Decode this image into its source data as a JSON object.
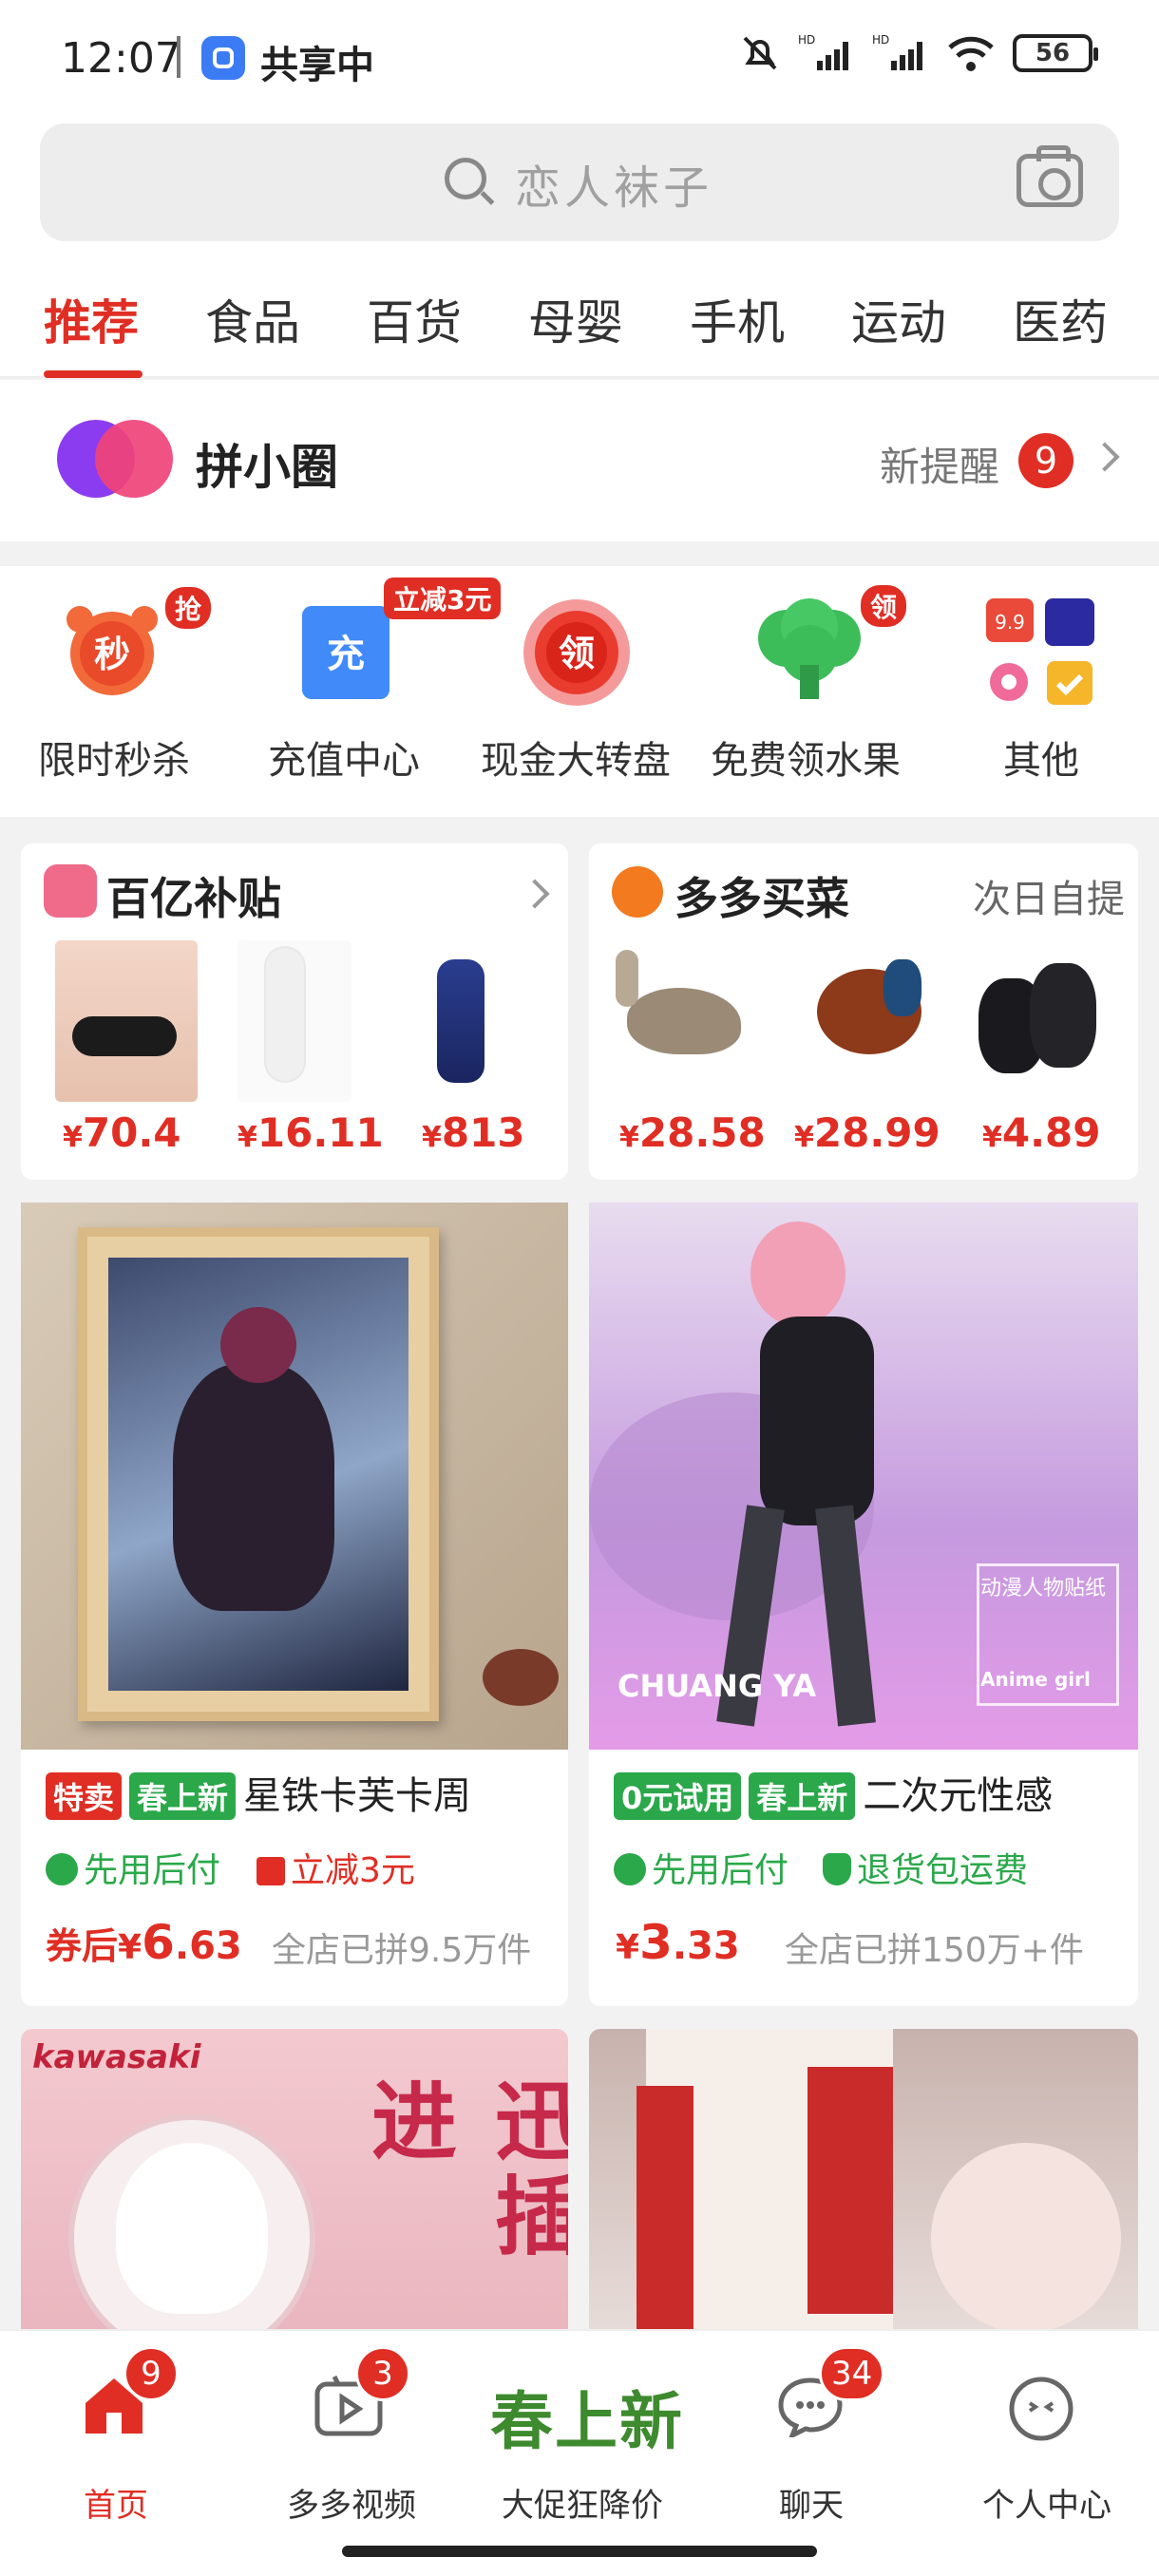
{
  "status": {
    "time": "12:07",
    "share_text": "共享中",
    "battery": "56"
  },
  "search": {
    "placeholder": "恋人袜子"
  },
  "tabs": [
    "推荐",
    "食品",
    "百货",
    "母婴",
    "手机",
    "运动",
    "医药"
  ],
  "pin": {
    "title": "拼小圈",
    "remind": "新提醒",
    "count": "9"
  },
  "quick": [
    {
      "label": "限时秒杀",
      "icon": "seckill-clock-icon",
      "glyph": "秒",
      "tag": "抢"
    },
    {
      "label": "充值中心",
      "icon": "recharge-icon",
      "glyph": "充",
      "tag": "立减3元"
    },
    {
      "label": "现金大转盘",
      "icon": "wheel-icon",
      "glyph": "领",
      "tag": ""
    },
    {
      "label": "免费领水果",
      "icon": "fruit-tree-icon",
      "glyph": "",
      "tag": "领"
    },
    {
      "label": "其他",
      "icon": "more-apps-icon",
      "glyph": "",
      "tag": ""
    }
  ],
  "subsidy": {
    "title": "百亿补贴",
    "prices": [
      "70.4",
      "16.11",
      "813"
    ]
  },
  "grocery": {
    "title": "多多买菜",
    "subtitle": "次日自提",
    "prices": [
      "28.58",
      "28.99",
      "4.89"
    ]
  },
  "currency": "¥",
  "products": [
    {
      "tag1": "特卖",
      "tag2": "春上新",
      "title": "星铁卡芙卡周",
      "feat1": "先用后付",
      "feat2": "立减3元",
      "price_prefix": "券后",
      "price_int": "6",
      "price_dec": ".63",
      "sold": "全店已拼9.5万件"
    },
    {
      "tag1": "0元试用",
      "tag2": "春上新",
      "title": "二次元性感",
      "feat1": "先用后付",
      "feat2": "退货包运费",
      "price_prefix": "",
      "price_int": "3",
      "price_dec": ".33",
      "sold": "全店已拼150万+件"
    }
  ],
  "img_texts": {
    "brand": "kawasaki",
    "chuangya": "CHUANG YA",
    "sticker": "动漫人物贴纸",
    "anime": "Anime girl",
    "promo": "迅插进"
  },
  "nav": [
    {
      "label": "首页",
      "badge": "9"
    },
    {
      "label": "多多视频",
      "badge": "3"
    },
    {
      "label": "大促狂降价",
      "big": "春上新"
    },
    {
      "label": "聊天",
      "badge": "34"
    },
    {
      "label": "个人中心"
    }
  ]
}
